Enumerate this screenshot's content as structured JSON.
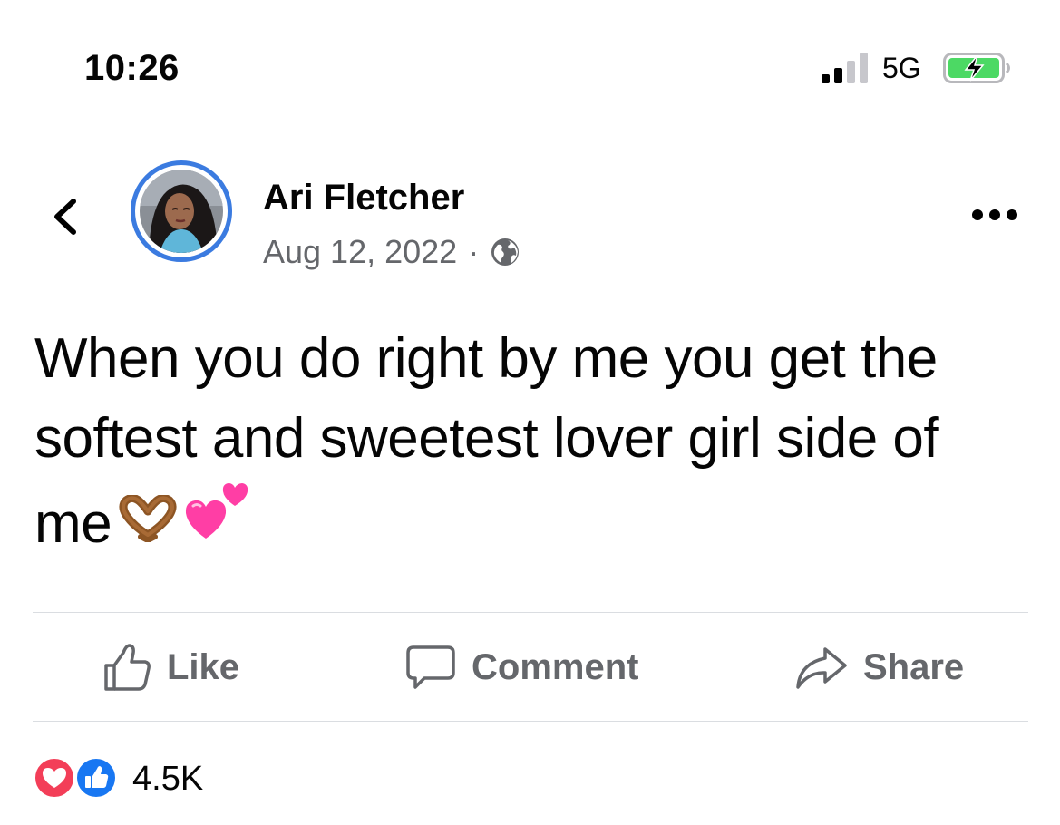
{
  "status_bar": {
    "time": "10:26",
    "network": "5G",
    "signal_bars_active": 2,
    "signal_bars_total": 4,
    "battery_charging": true
  },
  "post": {
    "author": "Ari Fletcher",
    "date": "Aug 12, 2022",
    "separator": "·",
    "audience_icon": "globe-icon",
    "text": "When you do right by me you get the softest and sweetest lover girl side of me",
    "emojis": [
      "heart-hands-emoji",
      "two-hearts-emoji"
    ]
  },
  "actions": {
    "like": "Like",
    "comment": "Comment",
    "share": "Share"
  },
  "reactions": {
    "types": [
      "love",
      "like"
    ],
    "count": "4.5K"
  },
  "colors": {
    "accent_blue": "#1877f2",
    "avatar_ring": "#3b7be0",
    "love_red": "#f33e58",
    "secondary_text": "#65676b",
    "battery_green": "#4cd964",
    "divider": "#dadde1"
  }
}
